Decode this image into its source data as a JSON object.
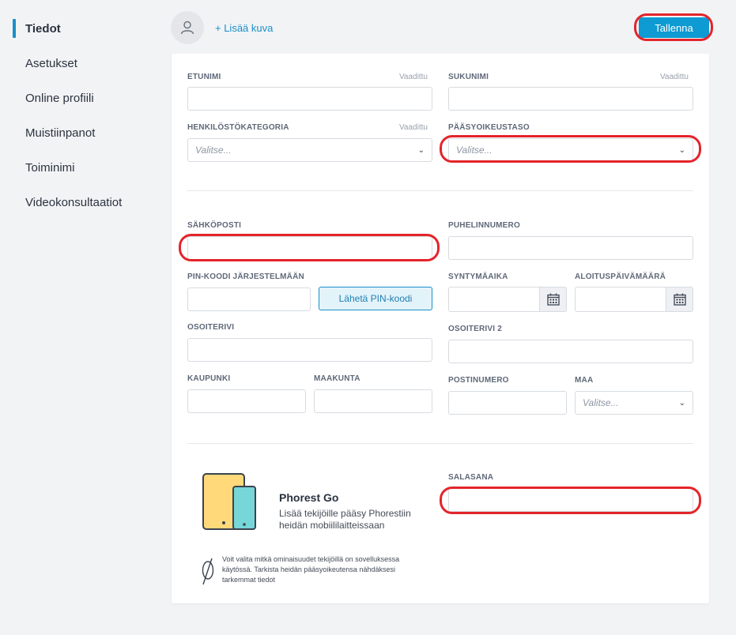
{
  "sidebar": {
    "items": [
      {
        "label": "Tiedot",
        "active": true
      },
      {
        "label": "Asetukset"
      },
      {
        "label": "Online profiili"
      },
      {
        "label": "Muistiinpanot"
      },
      {
        "label": "Toiminimi"
      },
      {
        "label": "Videokonsultaatiot"
      }
    ]
  },
  "header": {
    "add_photo": "+ Lisää kuva",
    "save": "Tallenna"
  },
  "form": {
    "first_name": {
      "label": "ETUNIMI",
      "required": "Vaadittu",
      "value": ""
    },
    "last_name": {
      "label": "SUKUNIMI",
      "required": "Vaadittu",
      "value": ""
    },
    "staff_category": {
      "label": "HENKILÖSTÖKATEGORIA",
      "required": "Vaadittu",
      "placeholder": "Valitse..."
    },
    "access_level": {
      "label": "PÄÄSYOIKEUSTASO",
      "placeholder": "Valitse..."
    },
    "email": {
      "label": "SÄHKÖPOSTI",
      "value": ""
    },
    "phone": {
      "label": "PUHELINNUMERO",
      "value": ""
    },
    "pin": {
      "label": "PIN-KOODI JÄRJESTELMÄÄN",
      "value": "",
      "send_button": "Lähetä PIN-koodi"
    },
    "birthday": {
      "label": "SYNTYMÄAIKA",
      "value": ""
    },
    "start_date": {
      "label": "ALOITUSPÄIVÄMÄÄRÄ",
      "value": ""
    },
    "address1": {
      "label": "OSOITERIVI",
      "value": ""
    },
    "address2": {
      "label": "OSOITERIVI 2",
      "value": ""
    },
    "city": {
      "label": "KAUPUNKI",
      "value": ""
    },
    "region": {
      "label": "MAAKUNTA",
      "value": ""
    },
    "postcode": {
      "label": "POSTINUMERO",
      "value": ""
    },
    "country": {
      "label": "MAA",
      "placeholder": "Valitse..."
    },
    "password": {
      "label": "SALASANA",
      "value": ""
    }
  },
  "phorest_go": {
    "title": "Phorest Go",
    "description": "Lisää tekijöille pääsy Phorestiin heidän mobiililaitteissaan",
    "note": "Voit valita mitkä ominaisuudet tekijöillä on sovelluksessa käytössä. Tarkista heidän pääsyoikeutensa nähdäksesi tarkemmat tiedot"
  },
  "colors": {
    "accent": "#0e9ad2",
    "highlight": "#e4242a",
    "background": "#f2f3f5"
  }
}
